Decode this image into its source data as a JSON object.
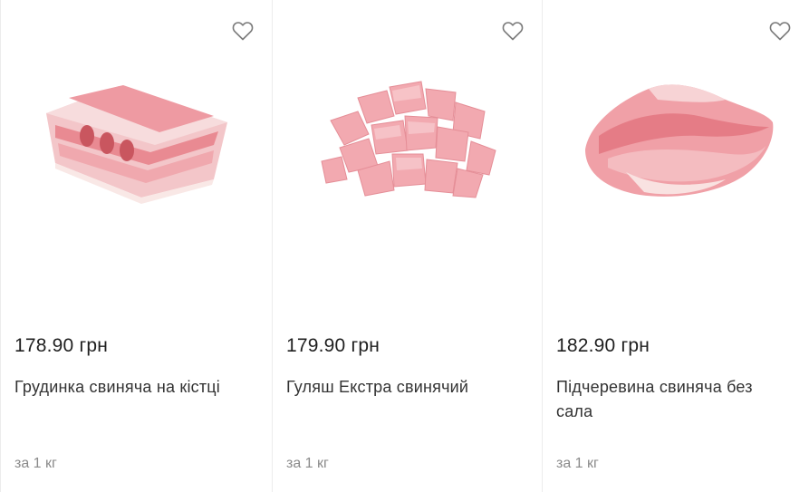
{
  "products": [
    {
      "price": "178.90 грн",
      "name": "Грудинка свиняча на кістці",
      "unit": "за 1 кг",
      "image": "pork-brisket-on-bone-image",
      "favorite_icon": "heart-outline-icon"
    },
    {
      "price": "179.90 грн",
      "name": "Гуляш Екстра свинячий",
      "unit": "за 1 кг",
      "image": "pork-goulash-cubes-image",
      "favorite_icon": "heart-outline-icon"
    },
    {
      "price": "182.90 грн",
      "name": "Підчеревина свиняча без сала",
      "unit": "за 1 кг",
      "image": "pork-belly-no-fat-image",
      "favorite_icon": "heart-outline-icon"
    }
  ],
  "colors": {
    "price_text": "#1f1f1f",
    "name_text": "#333333",
    "unit_text": "#8a8a8a",
    "divider": "#ececec",
    "heart_outline": "#7a7a7a"
  }
}
